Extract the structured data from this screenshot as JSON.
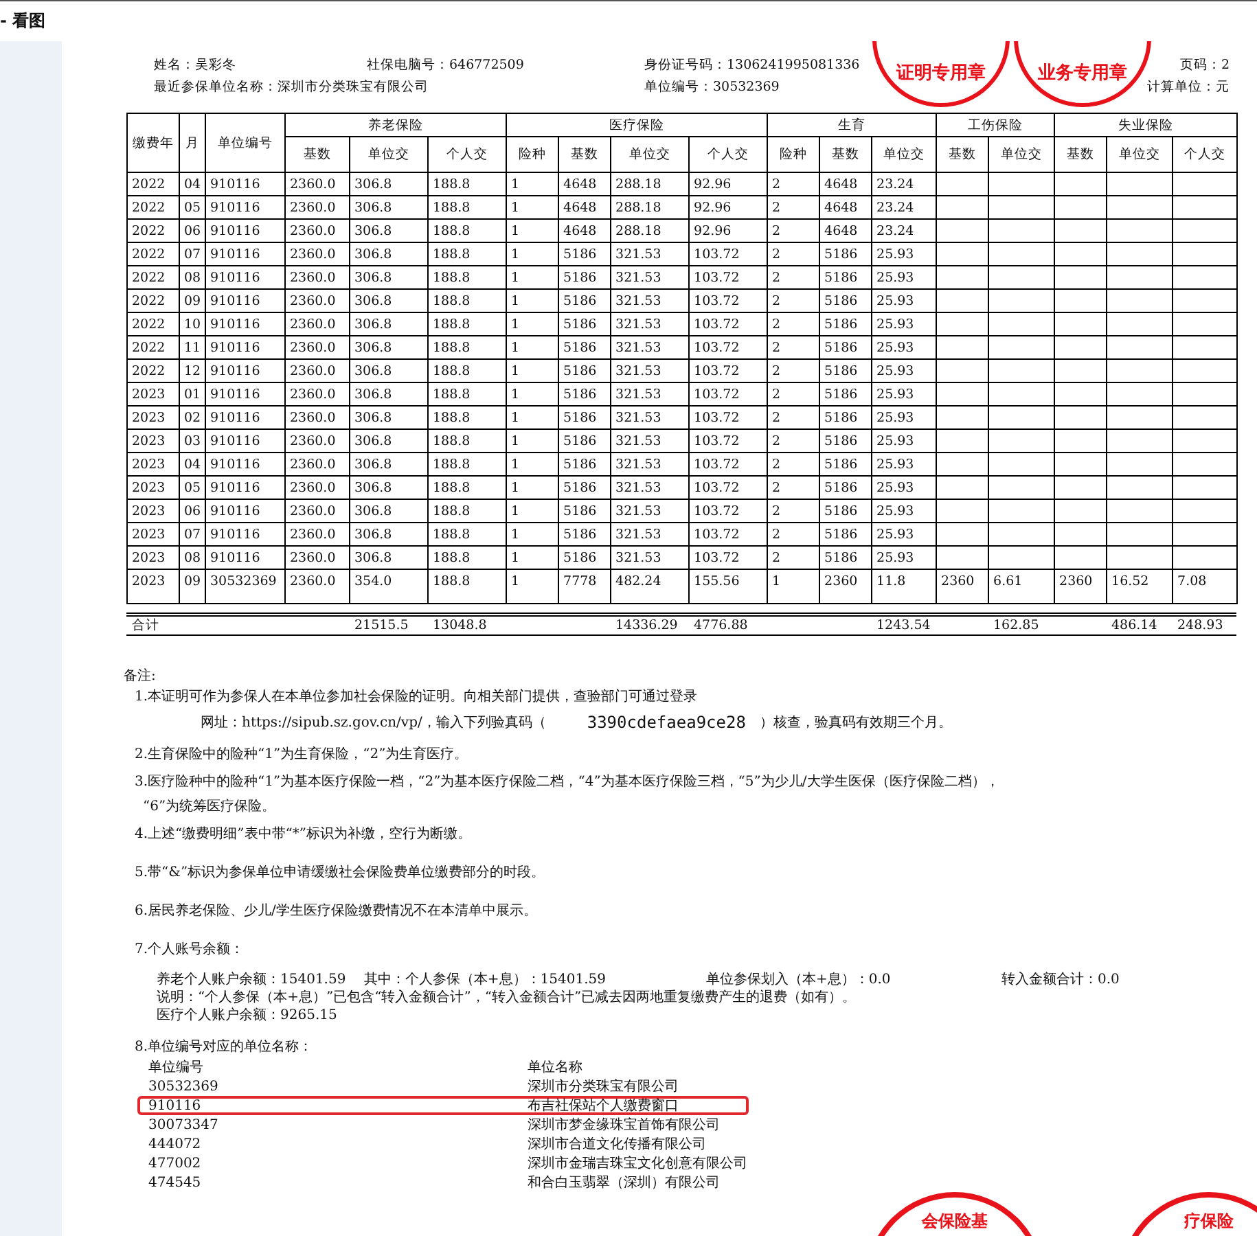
{
  "window": {
    "title": "- 看图"
  },
  "header": {
    "lines": [
      [
        {
          "text": "姓名：吴彩冬"
        },
        {
          "text": "社保电脑号：646772509"
        },
        {
          "text": "身份证号码：1306241995081336"
        }
      ],
      [
        {
          "text": "最近参保单位名称：深圳市分类珠宝有限公司"
        },
        {
          "text": "单位编号：30532369"
        },
        {
          "text": "计算单位：元"
        }
      ]
    ],
    "page": "页码：2"
  },
  "stamps": [
    {
      "kind": "top",
      "text": "证明专用章"
    },
    {
      "kind": "top",
      "text": "业务专用章"
    },
    {
      "kind": "bottom",
      "text": "会保险基"
    },
    {
      "kind": "bottom",
      "text": "疗保险"
    }
  ],
  "table": {
    "fixed_columns": [
      "缴费年",
      "月",
      "单位编号"
    ],
    "groups": [
      {
        "label": "养老保险",
        "columns": [
          "基数",
          "单位交",
          "个人交"
        ]
      },
      {
        "label": "医疗保险",
        "columns": [
          "险种",
          "基数",
          "单位交",
          "个人交"
        ]
      },
      {
        "label": "生育",
        "columns": [
          "险种",
          "基数",
          "单位交"
        ]
      },
      {
        "label": "工伤保险",
        "columns": [
          "基数",
          "单位交"
        ]
      },
      {
        "label": "失业保险",
        "columns": [
          "基数",
          "单位交",
          "个人交"
        ]
      }
    ],
    "rows": [
      [
        "2022",
        "04",
        "910116",
        "2360.0",
        "306.8",
        "188.8",
        "1",
        "4648",
        "288.18",
        "92.96",
        "2",
        "4648",
        "23.24"
      ],
      [
        "2022",
        "05",
        "910116",
        "2360.0",
        "306.8",
        "188.8",
        "1",
        "4648",
        "288.18",
        "92.96",
        "2",
        "4648",
        "23.24"
      ],
      [
        "2022",
        "06",
        "910116",
        "2360.0",
        "306.8",
        "188.8",
        "1",
        "4648",
        "288.18",
        "92.96",
        "2",
        "4648",
        "23.24"
      ],
      [
        "2022",
        "07",
        "910116",
        "2360.0",
        "306.8",
        "188.8",
        "1",
        "5186",
        "321.53",
        "103.72",
        "2",
        "5186",
        "25.93"
      ],
      [
        "2022",
        "08",
        "910116",
        "2360.0",
        "306.8",
        "188.8",
        "1",
        "5186",
        "321.53",
        "103.72",
        "2",
        "5186",
        "25.93"
      ],
      [
        "2022",
        "09",
        "910116",
        "2360.0",
        "306.8",
        "188.8",
        "1",
        "5186",
        "321.53",
        "103.72",
        "2",
        "5186",
        "25.93"
      ],
      [
        "2022",
        "10",
        "910116",
        "2360.0",
        "306.8",
        "188.8",
        "1",
        "5186",
        "321.53",
        "103.72",
        "2",
        "5186",
        "25.93"
      ],
      [
        "2022",
        "11",
        "910116",
        "2360.0",
        "306.8",
        "188.8",
        "1",
        "5186",
        "321.53",
        "103.72",
        "2",
        "5186",
        "25.93"
      ],
      [
        "2022",
        "12",
        "910116",
        "2360.0",
        "306.8",
        "188.8",
        "1",
        "5186",
        "321.53",
        "103.72",
        "2",
        "5186",
        "25.93"
      ],
      [
        "2023",
        "01",
        "910116",
        "2360.0",
        "306.8",
        "188.8",
        "1",
        "5186",
        "321.53",
        "103.72",
        "2",
        "5186",
        "25.93"
      ],
      [
        "2023",
        "02",
        "910116",
        "2360.0",
        "306.8",
        "188.8",
        "1",
        "5186",
        "321.53",
        "103.72",
        "2",
        "5186",
        "25.93"
      ],
      [
        "2023",
        "03",
        "910116",
        "2360.0",
        "306.8",
        "188.8",
        "1",
        "5186",
        "321.53",
        "103.72",
        "2",
        "5186",
        "25.93"
      ],
      [
        "2023",
        "04",
        "910116",
        "2360.0",
        "306.8",
        "188.8",
        "1",
        "5186",
        "321.53",
        "103.72",
        "2",
        "5186",
        "25.93"
      ],
      [
        "2023",
        "05",
        "910116",
        "2360.0",
        "306.8",
        "188.8",
        "1",
        "5186",
        "321.53",
        "103.72",
        "2",
        "5186",
        "25.93"
      ],
      [
        "2023",
        "06",
        "910116",
        "2360.0",
        "306.8",
        "188.8",
        "1",
        "5186",
        "321.53",
        "103.72",
        "2",
        "5186",
        "25.93"
      ],
      [
        "2023",
        "07",
        "910116",
        "2360.0",
        "306.8",
        "188.8",
        "1",
        "5186",
        "321.53",
        "103.72",
        "2",
        "5186",
        "25.93"
      ],
      [
        "2023",
        "08",
        "910116",
        "2360.0",
        "306.8",
        "188.8",
        "1",
        "5186",
        "321.53",
        "103.72",
        "2",
        "5186",
        "25.93"
      ],
      [
        "2023",
        "09",
        "30532369",
        "2360.0",
        "354.0",
        "188.8",
        "1",
        "7778",
        "482.24",
        "155.56",
        "1",
        "2360",
        "11.8",
        "2360",
        "6.61",
        "2360",
        "16.52",
        "7.08"
      ]
    ],
    "totals": {
      "label": "合计",
      "pension_unit": "21515.5",
      "pension_personal": "13048.8",
      "medical_unit": "14336.29",
      "medical_personal": "4776.88",
      "maternity_unit": "1243.54",
      "injury_unit": "162.85",
      "unemployment_unit": "486.14",
      "unemployment_personal": "248.93"
    }
  },
  "notes": {
    "title": "备注:",
    "items": [
      {
        "kind": "verify",
        "lines": [
          "1.本证明可作为参保人在本单位参加社会保险的证明。向相关部门提供，查验部门可通过登录"
        ],
        "prefix": "网址：https://sipub.sz.gov.cn/vp/，输入下列验真码（",
        "code": "3390cdefaea9ce28",
        "suffix": "）核查，验真码有效期三个月。"
      },
      {
        "kind": "text",
        "lines": [
          "2.生育保险中的险种“1”为生育保险，“2”为生育医疗。"
        ]
      },
      {
        "kind": "text",
        "lines": [
          "3.医疗险种中的险种“1”为基本医疗保险一档，“2”为基本医疗保险二档，“4”为基本医疗保险三档，“5”为少儿/大学生医保（医疗保险二档），",
          "“6”为统筹医疗保险。"
        ]
      },
      {
        "kind": "text",
        "lines": [
          "4.上述“缴费明细”表中带“*”标识为补缴，空行为断缴。"
        ]
      },
      {
        "kind": "text",
        "lines": [
          "5.带“&”标识为参保单位申请缓缴社会保险费单位缴费部分的时段。"
        ]
      },
      {
        "kind": "text",
        "lines": [
          "6.居民养老保险、少儿/学生医疗保险缴费情况不在本清单中展示。"
        ]
      },
      {
        "kind": "balance",
        "lines": [
          "7.个人账号余额："
        ],
        "balances": [
          "养老个人账户余额：15401.59　 其中：个人参保（本+息）：15401.59",
          "单位参保划入（本+息）：0.0",
          "转入金额合计：0.0"
        ],
        "details": [
          "说明：“个人参保（本+息）”已包含“转入金额合计”，“转入金额合计”已减去因两地重复缴费产生的退费（如有）。",
          "医疗个人账户余额：9265.15"
        ]
      },
      {
        "kind": "units",
        "lines": [
          "8.单位编号对应的单位名称："
        ],
        "headings": [
          "单位编号",
          "单位名称"
        ],
        "units": [
          {
            "code": "30532369",
            "name": "深圳市分类珠宝有限公司",
            "highlighted": false
          },
          {
            "code": "910116",
            "name": "布吉社保站个人缴费窗口",
            "highlighted": true
          },
          {
            "code": "30073347",
            "name": "深圳市梦金缘珠宝首饰有限公司",
            "highlighted": false
          },
          {
            "code": "444072",
            "name": "深圳市合道文化传播有限公司",
            "highlighted": false
          },
          {
            "code": "477002",
            "name": "深圳市金瑞吉珠宝文化创意有限公司",
            "highlighted": false
          },
          {
            "code": "474545",
            "name": "和合白玉翡翠（深圳）有限公司",
            "highlighted": false
          }
        ]
      }
    ]
  }
}
